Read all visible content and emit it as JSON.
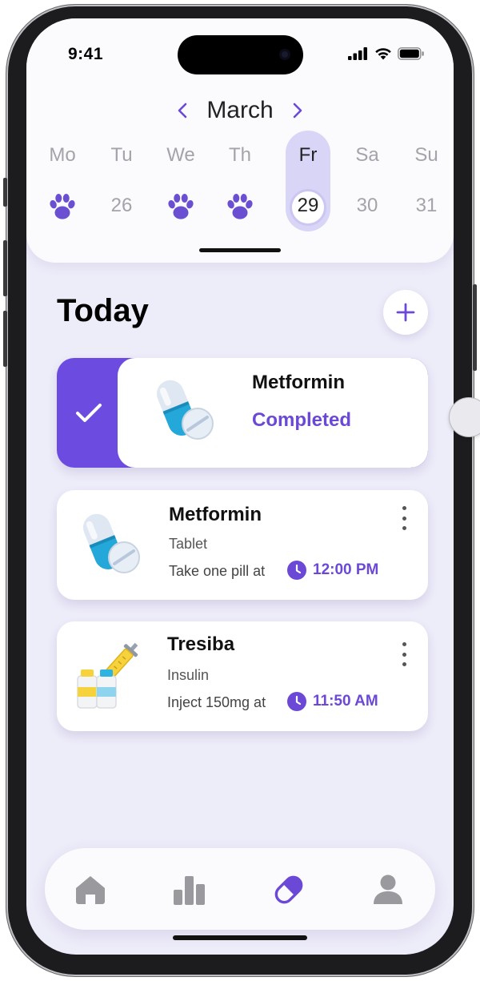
{
  "status_bar": {
    "time": "9:41",
    "icons": [
      "signal-icon",
      "wifi-icon",
      "battery-icon"
    ]
  },
  "calendar": {
    "month": "March",
    "prev_icon": "chevron-left-icon",
    "next_icon": "chevron-right-icon",
    "days": [
      {
        "name": "Mo",
        "value": "",
        "paw": true
      },
      {
        "name": "Tu",
        "value": "26",
        "paw": false
      },
      {
        "name": "We",
        "value": "",
        "paw": true
      },
      {
        "name": "Th",
        "value": "",
        "paw": true
      },
      {
        "name": "Fr",
        "value": "29",
        "paw": false,
        "selected": true
      },
      {
        "name": "Sa",
        "value": "30",
        "paw": false
      },
      {
        "name": "Su",
        "value": "31",
        "paw": false
      }
    ]
  },
  "today": {
    "title": "Today",
    "add_icon": "plus-icon"
  },
  "medications": [
    {
      "name": "Metformin",
      "status": "Completed",
      "completed": true,
      "icon": "pill-icon"
    },
    {
      "name": "Metformin",
      "type": "Tablet",
      "instruction": "Take one pill at",
      "time": "12:00 PM",
      "icon": "pill-icon"
    },
    {
      "name": "Tresiba",
      "type": "Insulin",
      "instruction": "Inject 150mg at",
      "time": "11:50 AM",
      "icon": "syringe-icon"
    }
  ],
  "nav": {
    "items": [
      "home-icon",
      "stats-icon",
      "pill-icon",
      "profile-icon"
    ],
    "active": "pill-icon"
  },
  "colors": {
    "accent": "#6b49d6",
    "background": "#edecf9",
    "selected_day": "#d9d5f7",
    "nav_inactive": "#9a9a9e"
  }
}
